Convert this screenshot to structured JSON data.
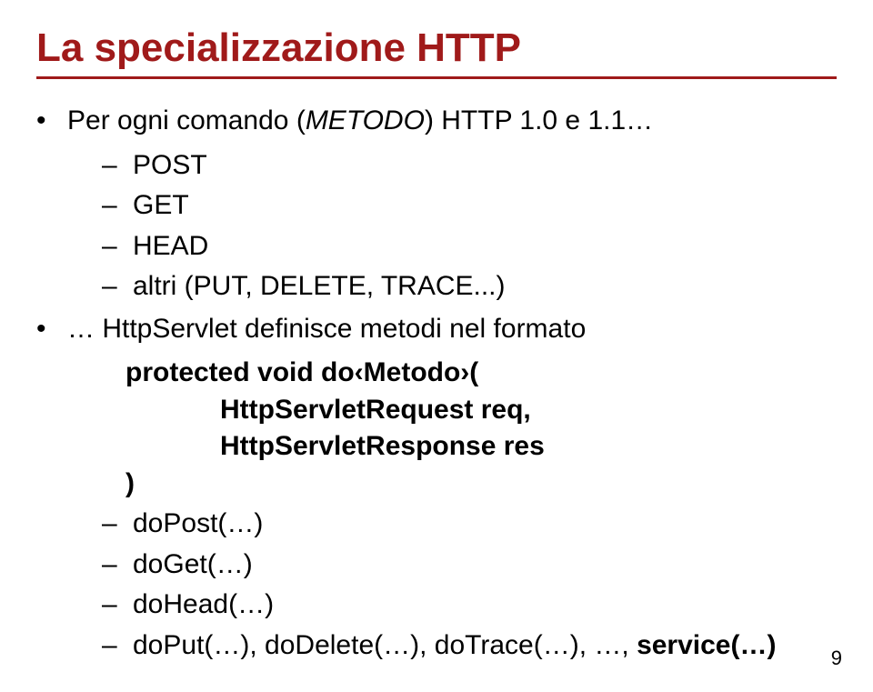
{
  "title": "La specializzazione HTTP",
  "bullet1": {
    "pre": "Per ogni comando (",
    "em": "METODO",
    "post": ") HTTP 1.0 e 1.1…"
  },
  "methods": [
    "POST",
    "GET",
    "HEAD",
    "altri (PUT, DELETE, TRACE...)"
  ],
  "bullet2": {
    "pre": "… HttpServlet definisce metodi nel formato"
  },
  "code": {
    "line1": "protected void do‹Metodo›(",
    "line2a": "HttpServletRequest req,",
    "line2b": "HttpServletResponse res",
    "line3": ")"
  },
  "impls": [
    "doPost(…)",
    "doGet(…)",
    "doHead(…)"
  ],
  "impls_last": {
    "pre": "doPut(…), doDelete(…), doTrace(…), …, ",
    "bold": "service(…)"
  },
  "page_number": "9"
}
